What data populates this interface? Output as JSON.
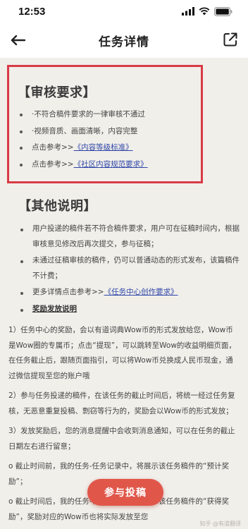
{
  "status_bar": {
    "time": "12:53"
  },
  "nav": {
    "title": "任务详情",
    "back_icon": "arrow-left-icon",
    "share_icon": "share-icon"
  },
  "review": {
    "heading": "【审核要求】",
    "items": [
      {
        "text": "·不符合稿件要求的一律审核不通过"
      },
      {
        "text": "·视频音质、画面清晰，内容完整"
      },
      {
        "prefix": "点击参考>>",
        "link": "《内容等级标准》"
      },
      {
        "prefix": "点击参考>>",
        "link": "《社区内容规范要求》"
      }
    ]
  },
  "other": {
    "heading": "【其他说明】",
    "items": [
      {
        "text": "用户投递的稿件若不符合稿件要求，用户可在征稿时间内，根据审核意见修改后再次提交，参与征稿；"
      },
      {
        "text": "未通过征稿审核的稿件，仍可以普通动态的形式发布，该篇稿件不计费；"
      },
      {
        "prefix": "更多详情点击参考>>",
        "link": "《任务中心创作要求》"
      },
      {
        "text": "奖励发放说明"
      }
    ]
  },
  "paragraphs": [
    "1）任务中心的奖励，会以有道词典Wow币的形式发放给您，Wow币是Wow圈的专属币；点击“提现”，可以跳转至Wow的收益明细页面，在任务截止后，跟随页面指引，可以将Wow币兑换成人民币现金，通过微信提现至您的账户哦",
    "2）参与任务投递的稿件，在该任务的截止时间后，将统一经过任务复核，无恶意重复投稿、剽窃等行为的，奖励会以Wow币的形式发放；",
    "3）发放奖励后，您的消息提醒中会收到消息通知，可以在任务的截止日期左右进行留意；",
    "o 截止时间前，我的任务-任务记录中，将展示该任务稿件的“预计奖励”；",
    "o 截止时间后，我的任务-任务记录中，将展示该任务稿件的“获得奖励”，奖励对应的Wow币也将实际发放至您"
  ],
  "submit_button": "参与投稿",
  "watermark": "知乎 @有道翻译"
}
